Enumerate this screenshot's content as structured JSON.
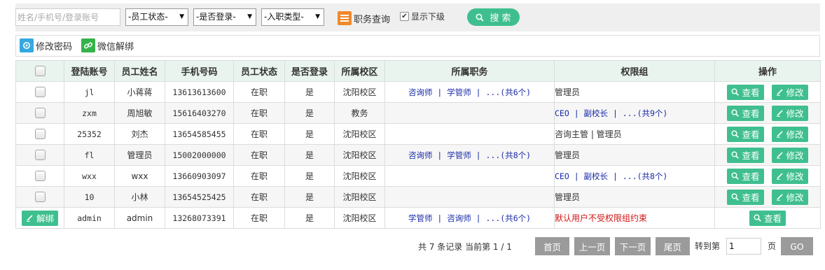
{
  "search": {
    "keyword_placeholder": "姓名/手机号/登录账号",
    "status_select": "-员工状态-",
    "login_select": "-是否登录-",
    "type_select": "-入职类型-",
    "job_query_label": "职务查询",
    "show_sub_label": "显示下级",
    "show_sub_checked": "✔",
    "search_label": "搜 索"
  },
  "toolbar": {
    "change_password": "修改密码",
    "wechat_unbind": "微信解绑"
  },
  "table": {
    "headers": [
      "登陆账号",
      "员工姓名",
      "手机号码",
      "员工状态",
      "是否登录",
      "所属校区",
      "所属职务",
      "权限组",
      "操作"
    ],
    "rows": [
      {
        "account": "jl",
        "name": "小蒋蒋",
        "phone": "13613613600",
        "status": "在职",
        "login": "是",
        "campus": "沈阳校区",
        "jobs": "咨询师 | 学管师 | ...(共6个)",
        "perm": "管理员",
        "perm_link": "",
        "perm_red": ""
      },
      {
        "account": "zxm",
        "name": "周旭敏",
        "phone": "15616403270",
        "status": "在职",
        "login": "是",
        "campus": "教务",
        "jobs": "",
        "perm": "",
        "perm_link": "CEO | 副校长 | ...(共9个)",
        "perm_red": ""
      },
      {
        "account": "25352",
        "name": "刘杰",
        "phone": "13654585455",
        "status": "在职",
        "login": "是",
        "campus": "沈阳校区",
        "jobs": "",
        "perm": "咨询主管 | 管理员",
        "perm_link": "",
        "perm_red": ""
      },
      {
        "account": "fl",
        "name": "管理员",
        "phone": "15002000000",
        "status": "在职",
        "login": "是",
        "campus": "沈阳校区",
        "jobs": "咨询师 | 学管师 | ...(共8个)",
        "perm": "管理员",
        "perm_link": "",
        "perm_red": ""
      },
      {
        "account": "wxx",
        "name": "wxx",
        "phone": "13660903097",
        "status": "在职",
        "login": "是",
        "campus": "沈阳校区",
        "jobs": "",
        "perm": "",
        "perm_link": "CEO | 副校长 | ...(共8个)",
        "perm_red": ""
      },
      {
        "account": "10",
        "name": "小林",
        "phone": "13654525425",
        "status": "在职",
        "login": "是",
        "campus": "沈阳校区",
        "jobs": "",
        "perm": "管理员",
        "perm_link": "",
        "perm_red": ""
      },
      {
        "account": "admin",
        "name": "admin",
        "phone": "13268073391",
        "status": "在职",
        "login": "是",
        "campus": "沈阳校区",
        "jobs": "学管师 | 咨询师 | ...(共6个)",
        "perm": "",
        "perm_link": "",
        "perm_red": "默认用户不受权限组约束"
      }
    ],
    "view_label": "查看",
    "edit_label": "修改",
    "unbind_label": "解绑"
  },
  "pager": {
    "summary": "共 7 条记录 当前第 1 / 1",
    "first": "首页",
    "prev": "上一页",
    "next": "下一页",
    "last": "尾页",
    "goto_label": "转到第",
    "page_value": "1",
    "page_suffix": "页",
    "go": "GO"
  },
  "colors": {
    "accent": "#3fbf8f",
    "header_bg": "#e9f4ee",
    "link": "#1a2aa8",
    "warning": "#d01515",
    "job_icon": "#f0892c"
  }
}
